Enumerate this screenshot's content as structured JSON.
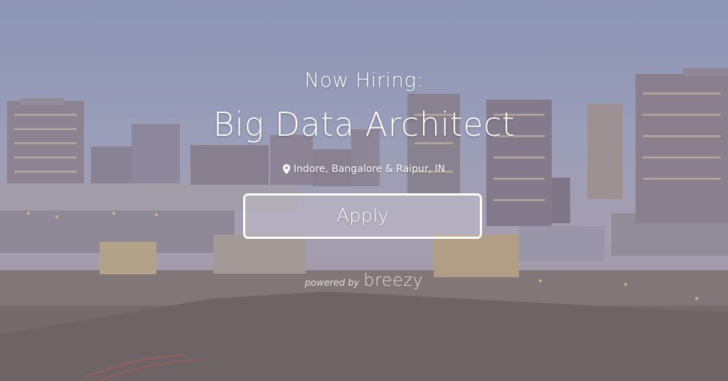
{
  "hero": {
    "hiring_label": "Now Hiring:",
    "job_title": "Big Data Architect",
    "location": "Indore, Bangalore & Raipur, IN",
    "apply_label": "Apply",
    "powered_by": "powered by",
    "brand": "breezy",
    "location_icon": "map-pin-icon",
    "accent_color": "#ffffff"
  }
}
